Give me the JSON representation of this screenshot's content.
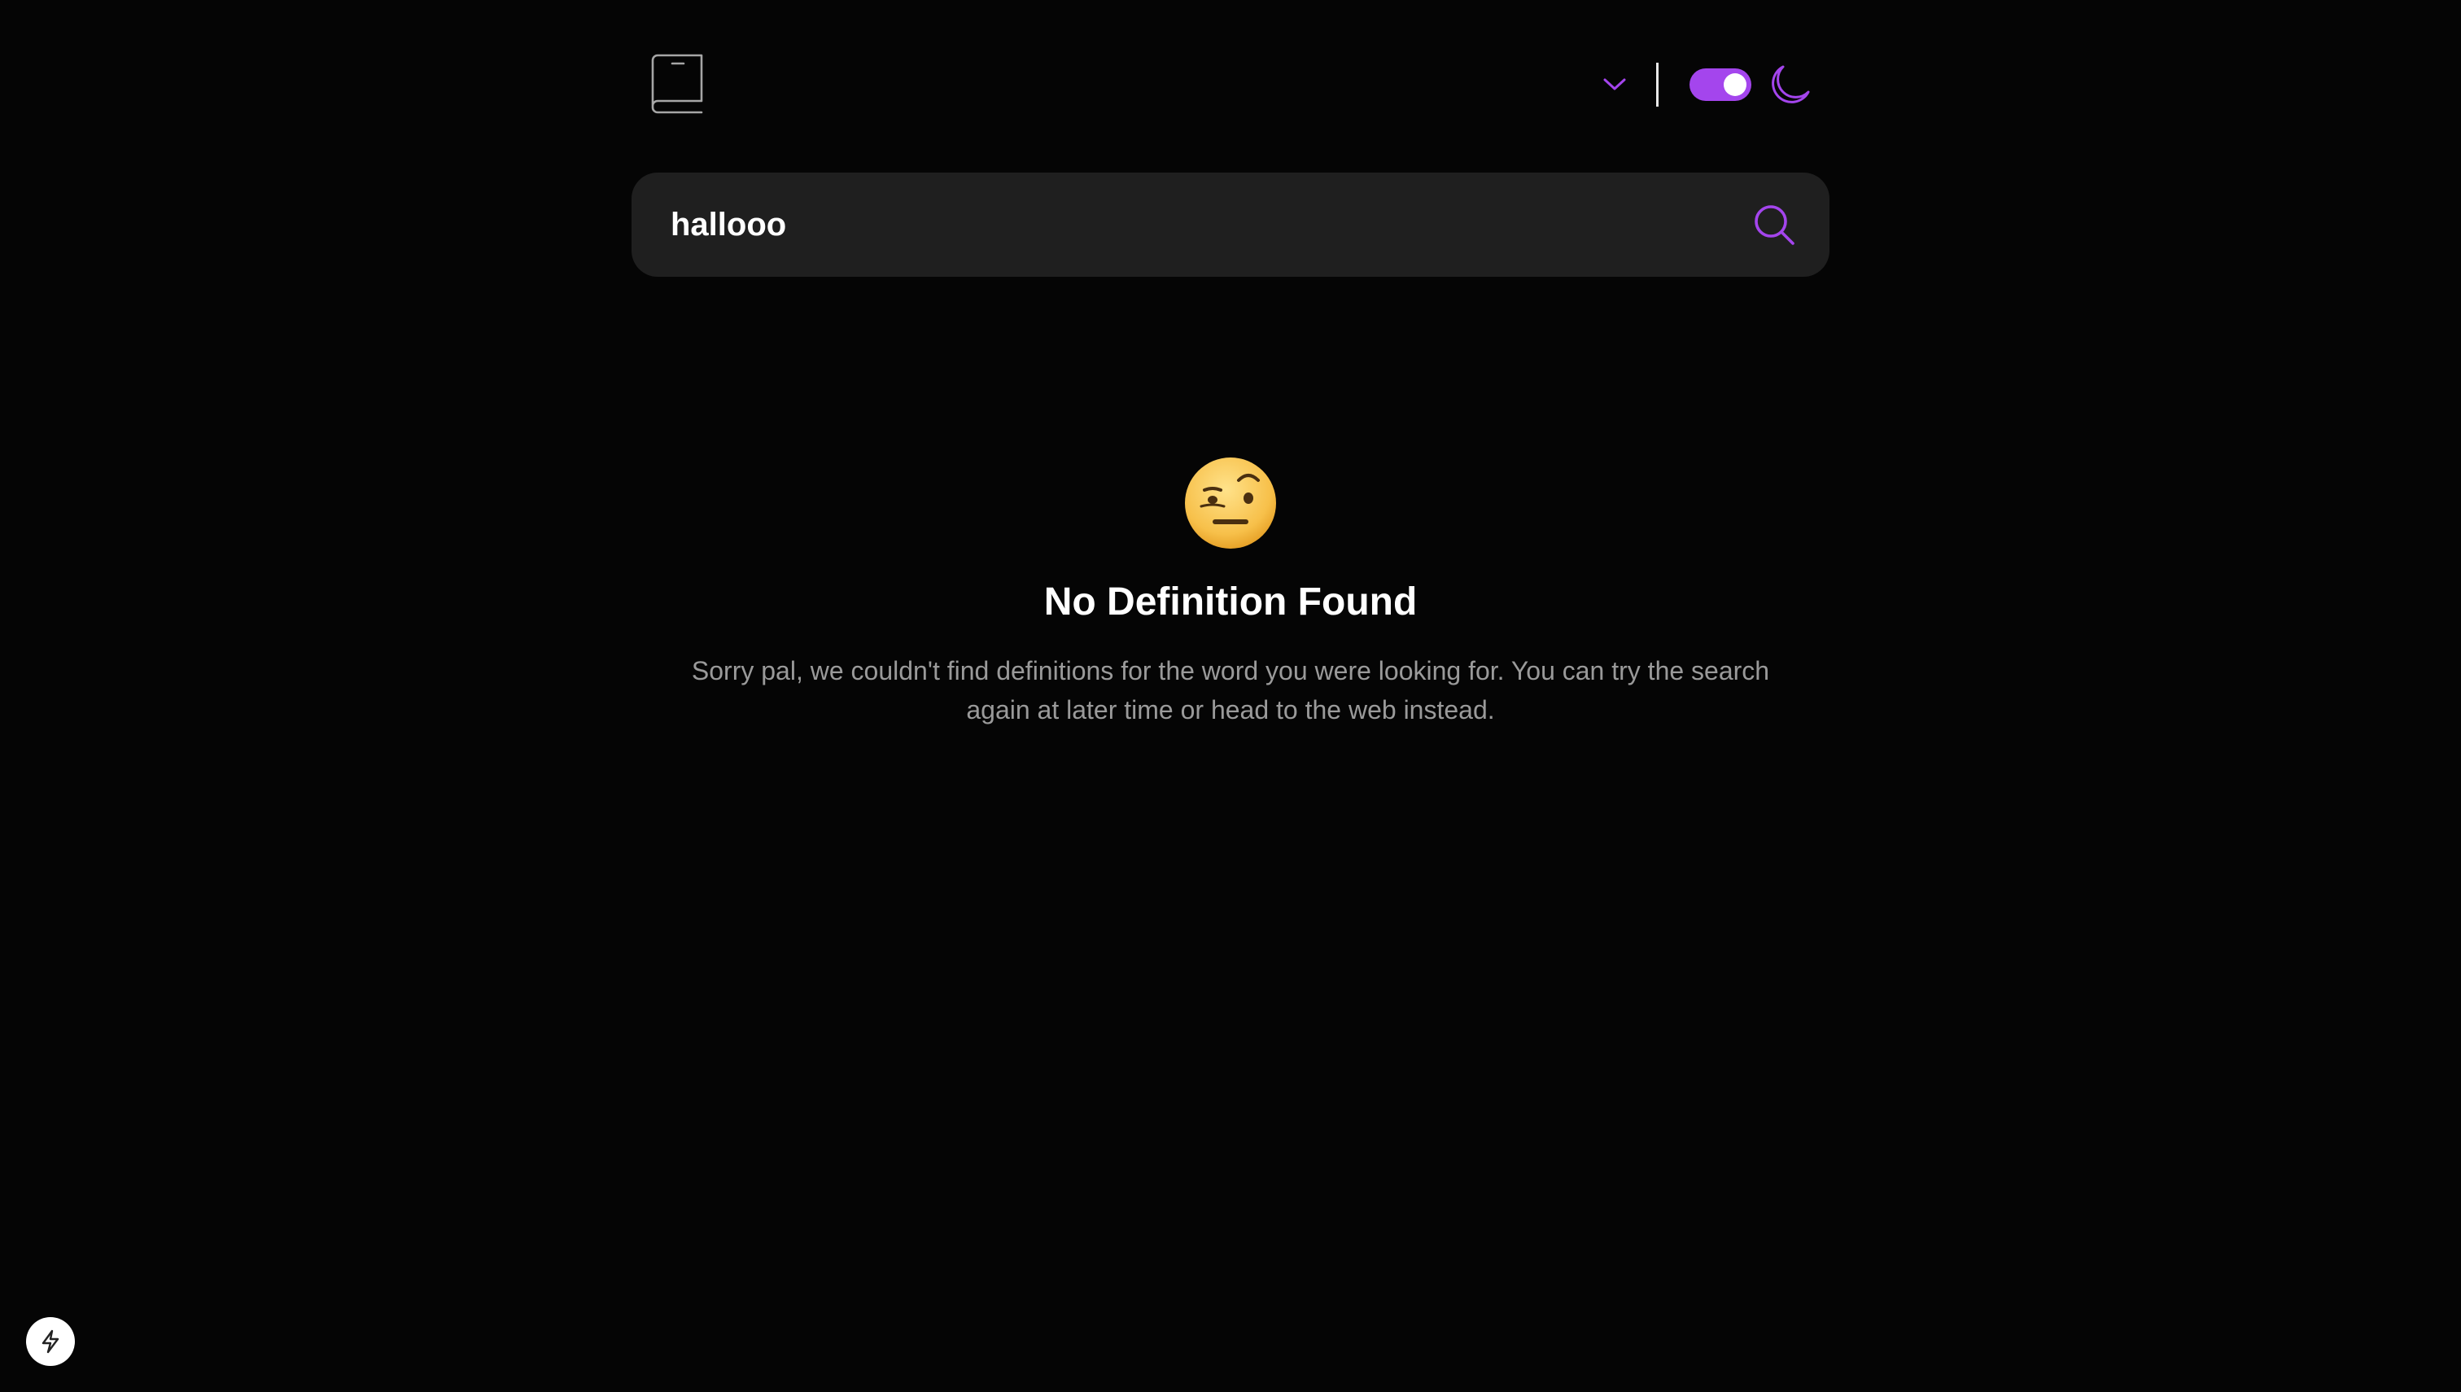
{
  "header": {
    "logo_icon": "book-icon",
    "font_selector": {
      "value": "",
      "icon": "chevron-down-icon"
    },
    "theme_toggle": {
      "state": "dark",
      "on": true,
      "icon": "moon-icon"
    }
  },
  "search": {
    "value": "hallooo",
    "placeholder": "",
    "icon": "search-icon"
  },
  "result": {
    "emoji": "face-with-raised-eyebrow",
    "title": "No Definition Found",
    "message": "Sorry pal, we couldn't find definitions for the word you were looking for. You can try the search again at later time or head to the web instead."
  },
  "dev_badge": {
    "icon": "lightning-bolt-icon"
  },
  "colors": {
    "background": "#050505",
    "surface": "#1f1f1f",
    "accent": "#a445ed",
    "text": "#ffffff",
    "muted_text": "#9a9a9a"
  }
}
